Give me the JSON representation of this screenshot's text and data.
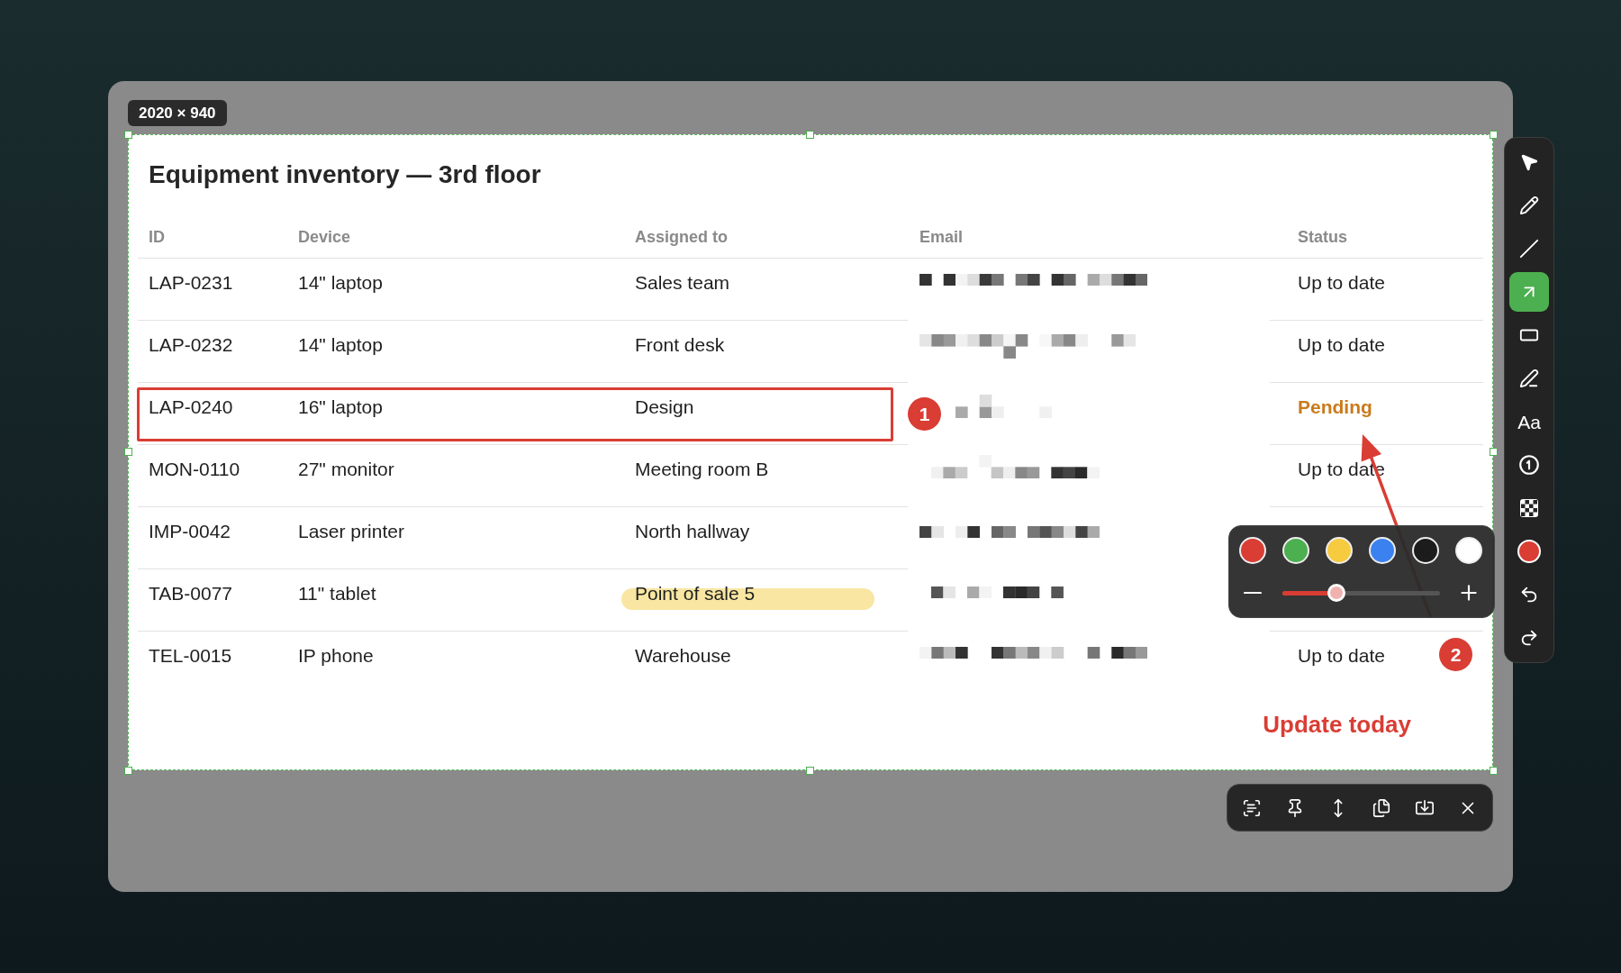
{
  "capture": {
    "size_label": "2020 × 940"
  },
  "document": {
    "title": "Equipment inventory — 3rd floor",
    "columns": [
      "ID",
      "Device",
      "Assigned to",
      "Email",
      "Status"
    ],
    "rows": [
      {
        "id": "LAP-0231",
        "device": "14\" laptop",
        "assigned_to": "Sales team",
        "email_pixelated": true,
        "status": "Up to date",
        "pending": false,
        "outlined": false,
        "highlighted": false
      },
      {
        "id": "LAP-0232",
        "device": "14\" laptop",
        "assigned_to": "Front desk",
        "email_pixelated": true,
        "status": "Up to date",
        "pending": false,
        "outlined": false,
        "highlighted": false
      },
      {
        "id": "LAP-0240",
        "device": "16\" laptop",
        "assigned_to": "Design",
        "email_pixelated": true,
        "email_marker": "1",
        "status": "Pending",
        "pending": true,
        "outlined": true,
        "highlighted": false
      },
      {
        "id": "MON-0110",
        "device": "27\" monitor",
        "assigned_to": "Meeting room B",
        "email_pixelated": true,
        "status": "Up to date",
        "pending": false,
        "outlined": false,
        "highlighted": false
      },
      {
        "id": "IMP-0042",
        "device": "Laser printer",
        "assigned_to": "North hallway",
        "email_pixelated": true,
        "outlined": false,
        "highlighted": false
      },
      {
        "id": "TAB-0077",
        "device": "11\" tablet",
        "assigned_to": "Point of sale 5",
        "email_pixelated": true,
        "outlined": false,
        "highlighted": true
      },
      {
        "id": "TEL-0015",
        "device": "IP phone",
        "assigned_to": "Warehouse",
        "email_pixelated": true,
        "status": "Up to date",
        "pending": false,
        "status_marker": "2",
        "outlined": false,
        "highlighted": false
      }
    ],
    "note": "Update today"
  },
  "toolbar": {
    "tools": [
      {
        "kind": "select",
        "selected": false
      },
      {
        "kind": "pencil",
        "selected": false
      },
      {
        "kind": "line",
        "selected": false
      },
      {
        "kind": "arrow",
        "selected": true
      },
      {
        "kind": "rectangle",
        "selected": false
      },
      {
        "kind": "marker",
        "selected": false
      },
      {
        "kind": "text",
        "label": "Aa",
        "selected": false
      },
      {
        "kind": "counter",
        "selected": false
      },
      {
        "kind": "mosaic",
        "selected": false
      }
    ],
    "color_button": {
      "color": "#d93d34"
    },
    "history": [
      {
        "kind": "undo"
      },
      {
        "kind": "redo"
      }
    ]
  },
  "palette": {
    "colors": [
      {
        "color": "#d93d34"
      },
      {
        "color": "#4caf50"
      },
      {
        "color": "#f6cb3f"
      },
      {
        "color": "#3b82f0"
      },
      {
        "color": "#1c1c1c"
      },
      {
        "color": "#ffffff"
      }
    ],
    "stroke_size": {
      "level": 0.34
    }
  },
  "capture_actions": [
    {
      "kind": "ocr"
    },
    {
      "kind": "pin"
    },
    {
      "kind": "vertical"
    },
    {
      "kind": "copy"
    },
    {
      "kind": "save"
    },
    {
      "kind": "close"
    }
  ]
}
